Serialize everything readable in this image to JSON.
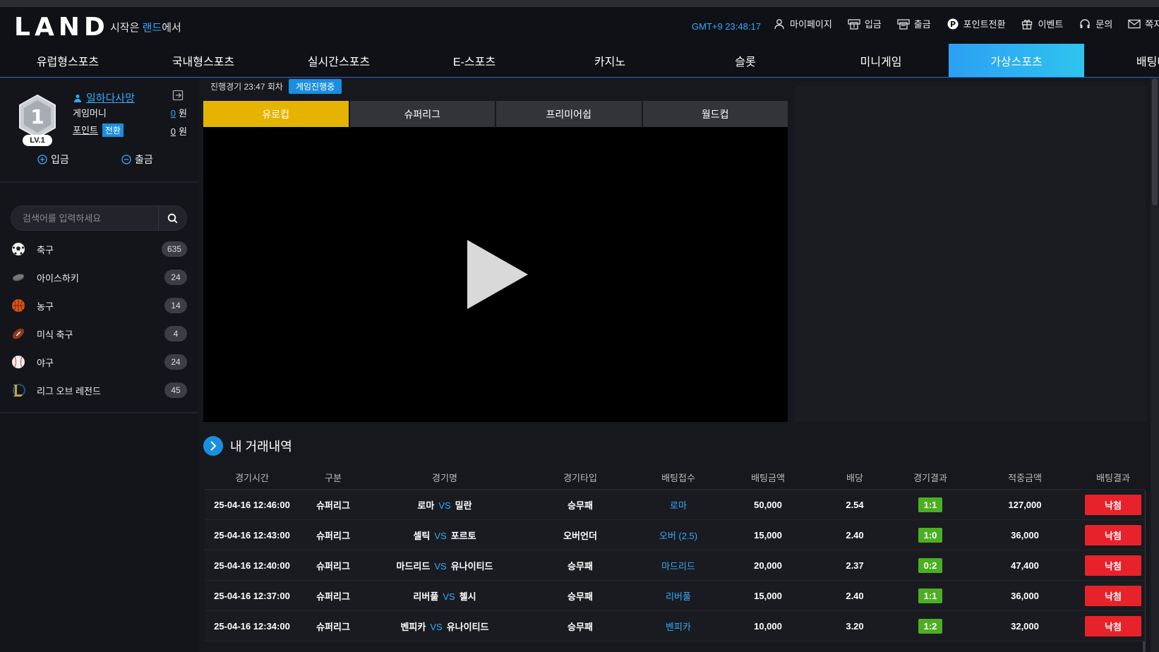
{
  "header": {
    "logo": "LAND",
    "tagline_prefix": "시작은 ",
    "tagline_highlight": "랜드",
    "tagline_suffix": "에서",
    "clock": "GMT+9 23:48:17",
    "links": [
      {
        "label": "마이페이지",
        "icon": "user-icon"
      },
      {
        "label": "입금",
        "icon": "deposit-icon"
      },
      {
        "label": "출금",
        "icon": "withdraw-icon"
      },
      {
        "label": "포인트전환",
        "icon": "point-icon"
      },
      {
        "label": "이벤트",
        "icon": "gift-icon"
      },
      {
        "label": "문의",
        "icon": "headset-icon"
      },
      {
        "label": "쪽지",
        "icon": "mail-icon"
      }
    ]
  },
  "nav": {
    "tabs": [
      "유럽형스포츠",
      "국내형스포츠",
      "실시간스포츠",
      "E-스포츠",
      "카지노",
      "슬롯",
      "미니게임",
      "가상스포츠",
      "배팅내"
    ],
    "active": "가상스포츠"
  },
  "sidebar": {
    "level_number": "1",
    "level_label": "LV.1",
    "username": "일하다사망",
    "money_label": "게임머니",
    "money_value": "0",
    "money_unit": "원",
    "point_label": "포인트",
    "point_convert": "전환",
    "point_value": "0",
    "point_unit": "원",
    "deposit_label": "입금",
    "withdraw_label": "출금",
    "search_placeholder": "검색어를 입력하세요",
    "sports": [
      {
        "name": "축구",
        "count": "635",
        "icon": "soccer-ball-icon"
      },
      {
        "name": "아이스하키",
        "count": "24",
        "icon": "hockey-puck-icon"
      },
      {
        "name": "농구",
        "count": "14",
        "icon": "basketball-icon"
      },
      {
        "name": "미식 축구",
        "count": "4",
        "icon": "football-icon"
      },
      {
        "name": "야구",
        "count": "24",
        "icon": "baseball-icon"
      },
      {
        "name": "리그 오브 레전드",
        "count": "45",
        "icon": "lol-icon"
      }
    ]
  },
  "game": {
    "status_text": "진행경기 23:47 회차",
    "status_badge": "게임진행중",
    "league_tabs": [
      "유로컵",
      "슈퍼리그",
      "프리미어쉽",
      "월드컵"
    ],
    "active_league": "유로컵"
  },
  "history": {
    "title": "내 거래내역",
    "columns": [
      "경기시간",
      "구분",
      "경기명",
      "경기타입",
      "배팅접수",
      "배팅금액",
      "배당",
      "경기결과",
      "적중금액",
      "배팅결과"
    ],
    "vs": "VS",
    "rows": [
      {
        "time": "25-04-16 12:46:00",
        "league": "슈퍼리그",
        "home": "로마",
        "away": "밀란",
        "type": "승무패",
        "pick": "로마",
        "amount": "50,000",
        "odds": "2.54",
        "score": "1:1",
        "win": "127,000",
        "result": "낙첨"
      },
      {
        "time": "25-04-16 12:43:00",
        "league": "슈퍼리그",
        "home": "셀틱",
        "away": "포르토",
        "type": "오버언더",
        "pick": "오버 (2.5)",
        "amount": "15,000",
        "odds": "2.40",
        "score": "1:0",
        "win": "36,000",
        "result": "낙첨"
      },
      {
        "time": "25-04-16 12:40:00",
        "league": "슈퍼리그",
        "home": "마드리드",
        "away": "유나이티드",
        "type": "승무패",
        "pick": "마드리드",
        "amount": "20,000",
        "odds": "2.37",
        "score": "0:2",
        "win": "47,400",
        "result": "낙첨"
      },
      {
        "time": "25-04-16 12:37:00",
        "league": "슈퍼리그",
        "home": "리버풀",
        "away": "첼시",
        "type": "승무패",
        "pick": "리버풀",
        "amount": "15,000",
        "odds": "2.40",
        "score": "1:1",
        "win": "36,000",
        "result": "낙첨"
      },
      {
        "time": "25-04-16 12:34:00",
        "league": "슈퍼리그",
        "home": "벤피카",
        "away": "유나이티드",
        "type": "승무패",
        "pick": "벤피카",
        "amount": "10,000",
        "odds": "3.20",
        "score": "1:2",
        "win": "32,000",
        "result": "낙첨"
      }
    ]
  },
  "colors": {
    "accent": "#33aaff",
    "active_tab": "#2ec4ee",
    "league_active": "#e5b400",
    "score": "#4caf23",
    "lose": "#e8222b"
  }
}
